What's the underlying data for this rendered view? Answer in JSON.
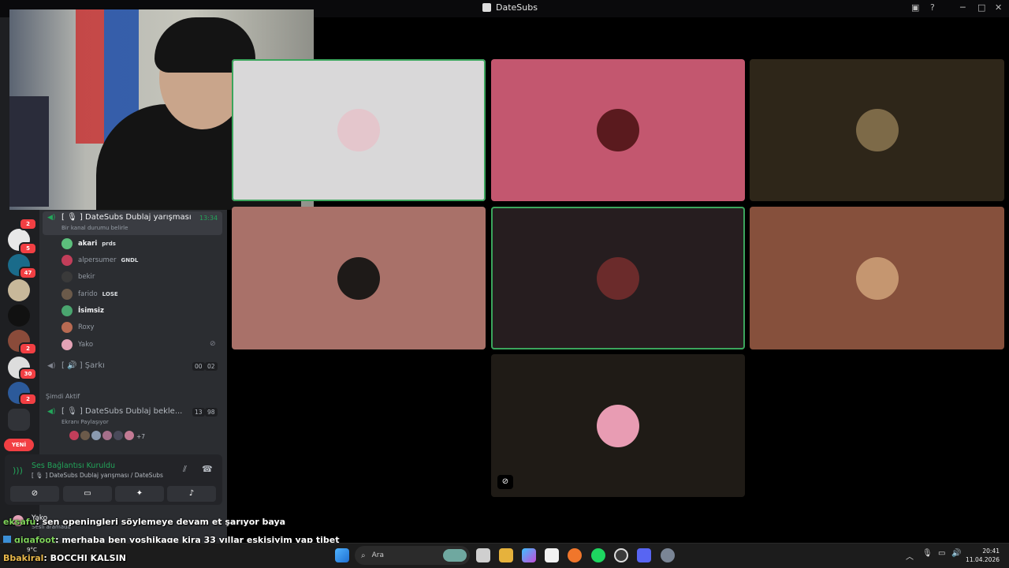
{
  "window": {
    "title": "DateSubs"
  },
  "servers": {
    "badges": [
      "2",
      "5",
      "47",
      "2",
      "30",
      "2"
    ],
    "new_label": "YENİ"
  },
  "sidebar": {
    "active_channel": {
      "name": "[ 🎙 ] DateSubs Dublaj yarışması",
      "time": "13:34",
      "status": "Bir kanal durumu belirle"
    },
    "members": [
      {
        "name": "akari",
        "tag": "prds",
        "color": "#5cbf7c"
      },
      {
        "name": "alpersumer",
        "tag": "GNDL",
        "color": "#c23e5a"
      },
      {
        "name": "bekir",
        "tag": "",
        "color": "#3a3a3a"
      },
      {
        "name": "farido",
        "tag": "LOSE",
        "color": "#6b5a4a"
      },
      {
        "name": "İsimsiz",
        "tag": "",
        "color": "#4aa56f"
      },
      {
        "name": "Roxy",
        "tag": "",
        "color": "#b86a52"
      },
      {
        "name": "Yako",
        "tag": "",
        "color": "#e4a2b6"
      }
    ],
    "song_channel": {
      "name": "[ 🔊 ] Şarkı",
      "count_a": "00",
      "count_b": "02"
    },
    "active_now_header": "Şimdi Aktif",
    "active_now": {
      "name": "[ 🎙 ] DateSubs Dublaj bekle...",
      "count_a": "13",
      "count_b": "98",
      "sub": "Ekranı Paylaşıyor",
      "extra": "+7"
    }
  },
  "voice": {
    "status": "Ses Bağlantısı Kuruldu",
    "channel": "[ 🎙 ] DateSubs Dublaj yarışması / DateSubs",
    "user_name": "Yako",
    "user_sub": "Sesli aramada"
  },
  "chat_overlay": [
    {
      "user": "eksafu",
      "message": ": sen openingleri söylemeye devam et şarıyor baya"
    },
    {
      "user": "gigafoot",
      "message": ": merhaba ben yoshikage kira 33 yıllar eskisiyim yap tibet"
    },
    {
      "user": "Bbakiral",
      "message": ": BOCCHI KALSIN"
    }
  ],
  "tiles": [
    {
      "bg": "#d9d8d9",
      "avatar": "#e4c6cc",
      "speaking": true
    },
    {
      "bg": "#c3576f",
      "avatar": "#5a1a1e",
      "speaking": false
    },
    {
      "bg": "#2e2619",
      "avatar": "#7d6a48",
      "speaking": false
    },
    {
      "bg": "#a97169",
      "avatar": "#1e1a18",
      "speaking": false
    },
    {
      "bg": "#261d1f",
      "avatar": "#6b2b2b",
      "speaking": true
    },
    {
      "bg": "#86503c",
      "avatar": "#c59670",
      "speaking": false
    },
    {
      "bg": "#1f1b16",
      "avatar": "#e89cb3",
      "speaking": false
    }
  ],
  "taskbar": {
    "search_placeholder": "Ara",
    "weather": "9°C",
    "time": "20:41",
    "date": "11.04.2026"
  }
}
